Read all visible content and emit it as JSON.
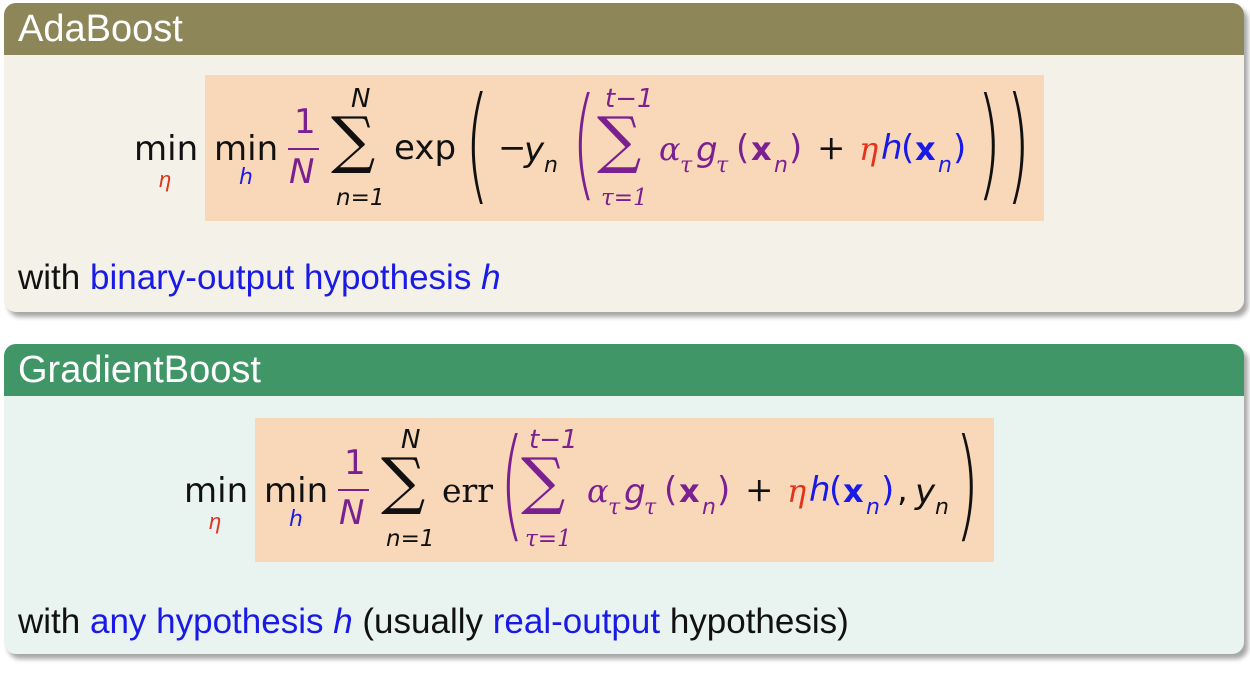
{
  "adaboost": {
    "title": "AdaBoost",
    "formula": {
      "min_outer": "min",
      "min_outer_sub": "η",
      "min_inner": "min",
      "min_inner_sub": "h",
      "frac_num": "1",
      "frac_den": "N",
      "sum_top": "N",
      "sum_symbol": "∑",
      "sum_bottom": "n=1",
      "func": "exp",
      "lparen1": "(",
      "minus": "−",
      "y": "y",
      "y_sub": "n",
      "lparen2": "(",
      "inner_sum_top": "t−1",
      "inner_sum_symbol": "∑",
      "inner_sum_bottom": "τ=1",
      "alpha": "α",
      "alpha_sub": "τ",
      "g": "g",
      "g_sub": "τ",
      "g_lp": "(",
      "x": "x",
      "x_sub": "n",
      "g_rp": ")",
      "plus": "+",
      "eta": "η",
      "h": "h",
      "h_lp": "(",
      "hx": "x",
      "hx_sub": "n",
      "h_rp": ")",
      "rparen2": ")",
      "rparen1": ")"
    },
    "caption": {
      "with": "with",
      "kw": "binary-output hypothesis",
      "h": "h"
    }
  },
  "gradientboost": {
    "title": "GradientBoost",
    "formula": {
      "min_outer": "min",
      "min_outer_sub": "η",
      "min_inner": "min",
      "min_inner_sub": "h",
      "frac_num": "1",
      "frac_den": "N",
      "sum_top": "N",
      "sum_symbol": "∑",
      "sum_bottom": "n=1",
      "func": "err",
      "lparen": "(",
      "inner_sum_top": "t−1",
      "inner_sum_symbol": "∑",
      "inner_sum_bottom": "τ=1",
      "alpha": "α",
      "alpha_sub": "τ",
      "g": "g",
      "g_sub": "τ",
      "g_lp": "(",
      "x": "x",
      "x_sub": "n",
      "g_rp": ")",
      "plus": "+",
      "eta": "η",
      "h": "h",
      "h_lp": "(",
      "hx": "x",
      "hx_sub": "n",
      "h_rp": ")",
      "comma": ",",
      "y": "y",
      "y_sub": "n",
      "rparen": ")"
    },
    "caption": {
      "with": "with",
      "kw": "any hypothesis",
      "h": "h",
      "rest1": "(usually",
      "kw2": "real-output",
      "rest2": "hypothesis)"
    }
  },
  "colors": {
    "adaboost_header": "#8c8658",
    "gradientboost_header": "#419668",
    "formula_box": "#f9d8b9",
    "keyword_blue": "#1a1ae6",
    "purple": "#7b2090",
    "eta_red": "#e2341c"
  }
}
